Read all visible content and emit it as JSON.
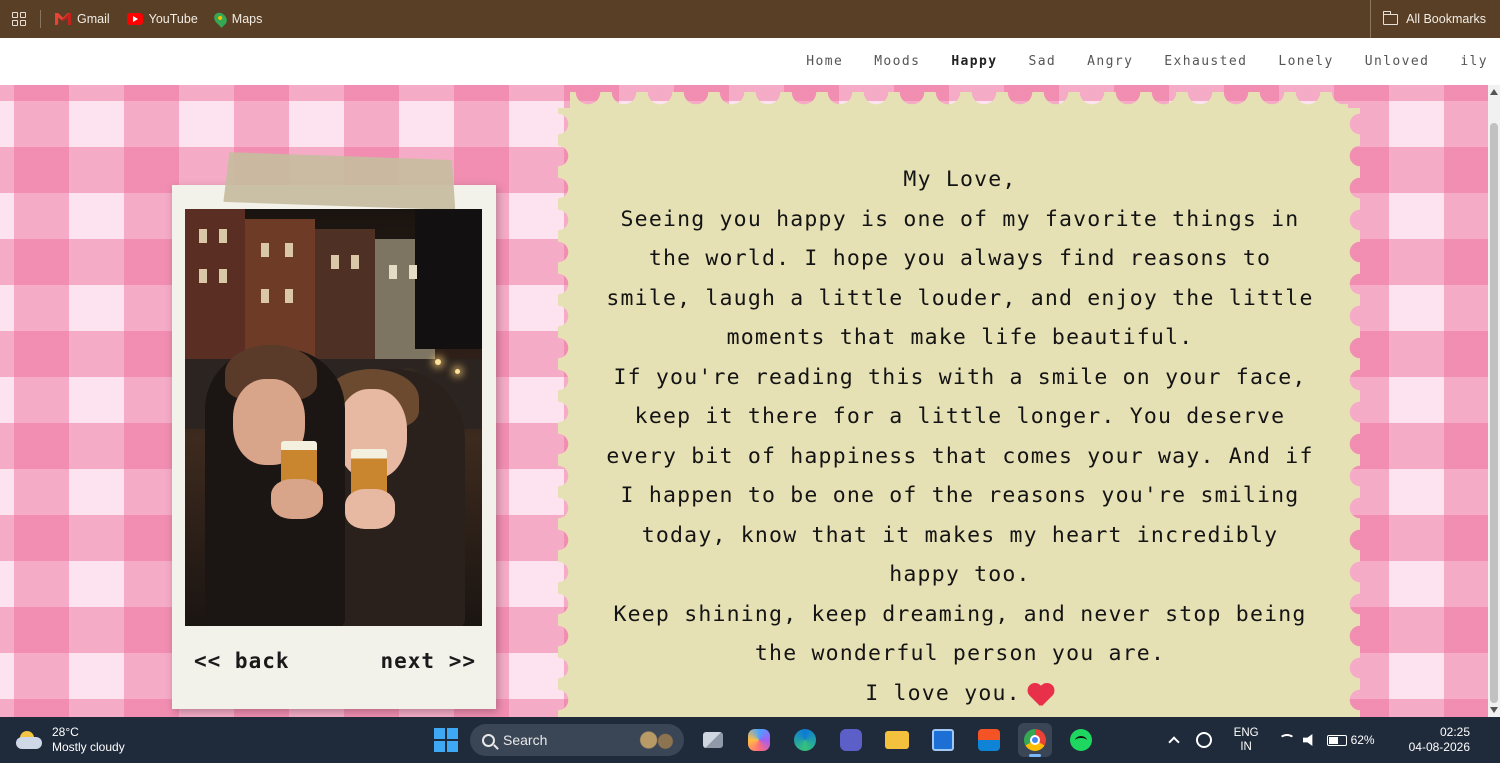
{
  "bookmarks": {
    "items": [
      {
        "label": "Gmail",
        "icon": "gmail-icon"
      },
      {
        "label": "YouTube",
        "icon": "youtube-icon"
      },
      {
        "label": "Maps",
        "icon": "maps-icon"
      }
    ],
    "all_bookmarks": "All Bookmarks"
  },
  "nav": {
    "links": [
      "Home",
      "Moods",
      "Happy",
      "Sad",
      "Angry",
      "Exhausted",
      "Lonely",
      "Unloved",
      "ily"
    ],
    "active": "Happy"
  },
  "polaroid": {
    "back_label": "<< back",
    "next_label": "next >>"
  },
  "letter": {
    "paragraphs": [
      "My Love,",
      "Seeing you happy is one of my favorite things in the world. I hope you always find reasons to smile, laugh a little louder, and enjoy the little moments that make life beautiful.",
      "If you're reading this with a smile on your face, keep it there for a little longer. You deserve every bit of happiness that comes your way. And if I happen to be one of the reasons you're smiling today, know that it makes my heart incredibly happy too.",
      "Keep shining, keep dreaming, and never stop being the wonderful person you are.",
      "I love you."
    ],
    "closing_icon": "heart-icon"
  },
  "taskbar": {
    "weather_temp": "28°C",
    "weather_desc": "Mostly cloudy",
    "search_placeholder": "Search",
    "lang_line1": "ENG",
    "lang_line2": "IN",
    "battery": "62%",
    "time": "02:25",
    "date": "04-08-2026"
  },
  "colors": {
    "bookmark_bar": "#583f25",
    "gingham_pink": "#eb6996",
    "letter_paper": "#e6e0b5",
    "polaroid": "#f2f1ea",
    "heart": "#e8304a"
  }
}
